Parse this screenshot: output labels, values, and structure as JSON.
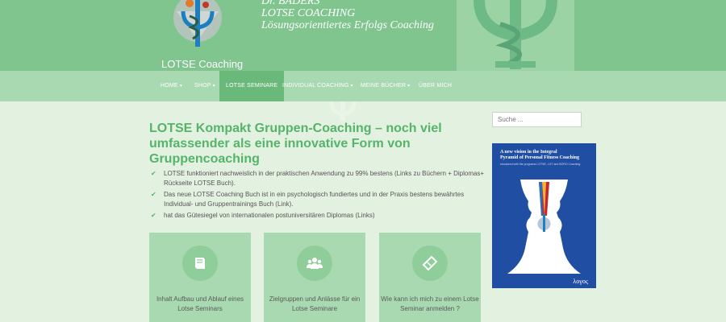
{
  "header": {
    "tagline_lines": [
      "Dr. BADERS",
      "LOTSE COACHING",
      "Lösungsorientiertes Erfolgs Coaching"
    ],
    "site_title": "LOTSE Coaching",
    "colors": {
      "header_bg": "#7fc58d",
      "nav_bg": "#a9d9b0",
      "accent": "#55b36a",
      "page_bg": "#e3f2e0"
    }
  },
  "nav": {
    "items": [
      {
        "label": "HOME",
        "has_caret": true
      },
      {
        "label": "SHOP",
        "has_caret": true
      },
      {
        "label": "LOTSE SEMINARE",
        "has_caret": false,
        "active": true
      },
      {
        "label": "INDIVIDUAL COACHING",
        "has_caret": true
      },
      {
        "label": "MEINE BÜCHER",
        "has_caret": true
      },
      {
        "label": "ÜBER MICH",
        "has_caret": false
      }
    ]
  },
  "main": {
    "title": "LOTSE Kompakt Gruppen-Coaching – noch viel umfassender als eine innovative Form von Gruppencoaching",
    "bullets": [
      "LOTSE funktioniert nachweislich in der praktischen Anwendung zu 99% bestens (Links zu Büchern + Diplomas+ Rückseite LOTSE Buch).",
      "Das neue LOTSE Coaching Buch ist in ein psychologisch fundiertes und in der Praxis bestens bewährtes Individual- und Gruppentrainings Buch (Link).",
      "hat das Gütesiegel von internationalen postuniversitären Diplomas (Links)"
    ],
    "cards": [
      {
        "icon": "book-icon",
        "text": "Inhalt Aufbau und Ablauf eines Lotse Seminars"
      },
      {
        "icon": "group-icon",
        "text": "Zielgruppen und Anlässe für ein Lotse Seminare"
      },
      {
        "icon": "ticket-icon",
        "text": "Wie kann ich mich zu einem Lotse Seminar anmelden ?"
      }
    ]
  },
  "sidebar": {
    "search_placeholder": "Suche ...",
    "book": {
      "title_line1": "A new vision in the Integral",
      "title_line2": "Pyramid of Personal Fitness Coaching",
      "subtitle": "structured with the programs LOTSE, LGT and BORO Coaching",
      "publisher": "λογος"
    }
  }
}
